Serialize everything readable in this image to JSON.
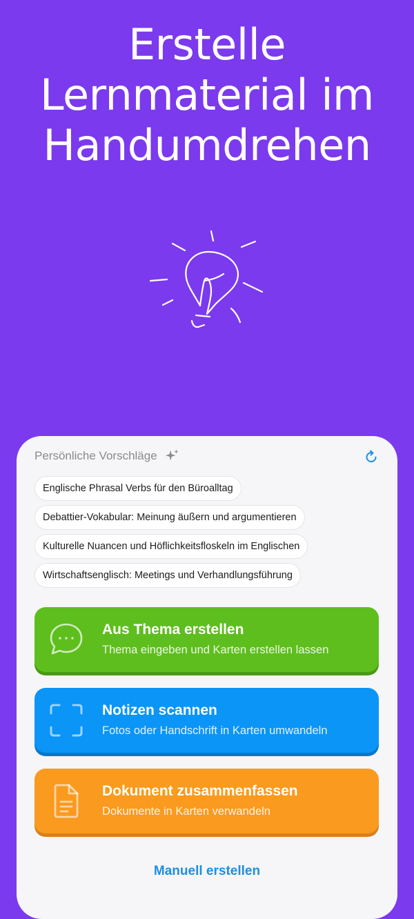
{
  "headline": {
    "line1": "Erstelle",
    "line2": "Lernmaterial im",
    "line3": "Handumdrehen"
  },
  "illustration": {
    "icon": "lightbulb-icon"
  },
  "suggestions": {
    "header": "Persönliche Vorschläge",
    "header_icon": "sparkle-icon",
    "refresh_icon": "refresh-icon",
    "chips": [
      "Englische Phrasal Verbs für den Büroalltag",
      "Debattier-Vokabular: Meinung äußern und argumentieren",
      "Kulturelle Nuancen und Höflichkeitsfloskeln im Englischen",
      "Wirtschaftsenglisch: Meetings und Verhandlungsführung"
    ]
  },
  "actions": [
    {
      "title": "Aus Thema erstellen",
      "subtitle": "Thema eingeben und Karten erstellen lassen",
      "icon": "chat-bubble-icon",
      "color": "#5EBE1E"
    },
    {
      "title": "Notizen scannen",
      "subtitle": "Fotos oder Handschrift in Karten umwandeln",
      "icon": "scan-frame-icon",
      "color": "#0A95F7"
    },
    {
      "title": "Dokument zusammenfassen",
      "subtitle": "Dokumente in Karten verwandeln",
      "icon": "document-icon",
      "color": "#FA9A1E"
    }
  ],
  "manual_link": "Manuell erstellen",
  "colors": {
    "background": "#7B3AED",
    "card": "#F6F6F8",
    "link": "#1A8FE3"
  }
}
